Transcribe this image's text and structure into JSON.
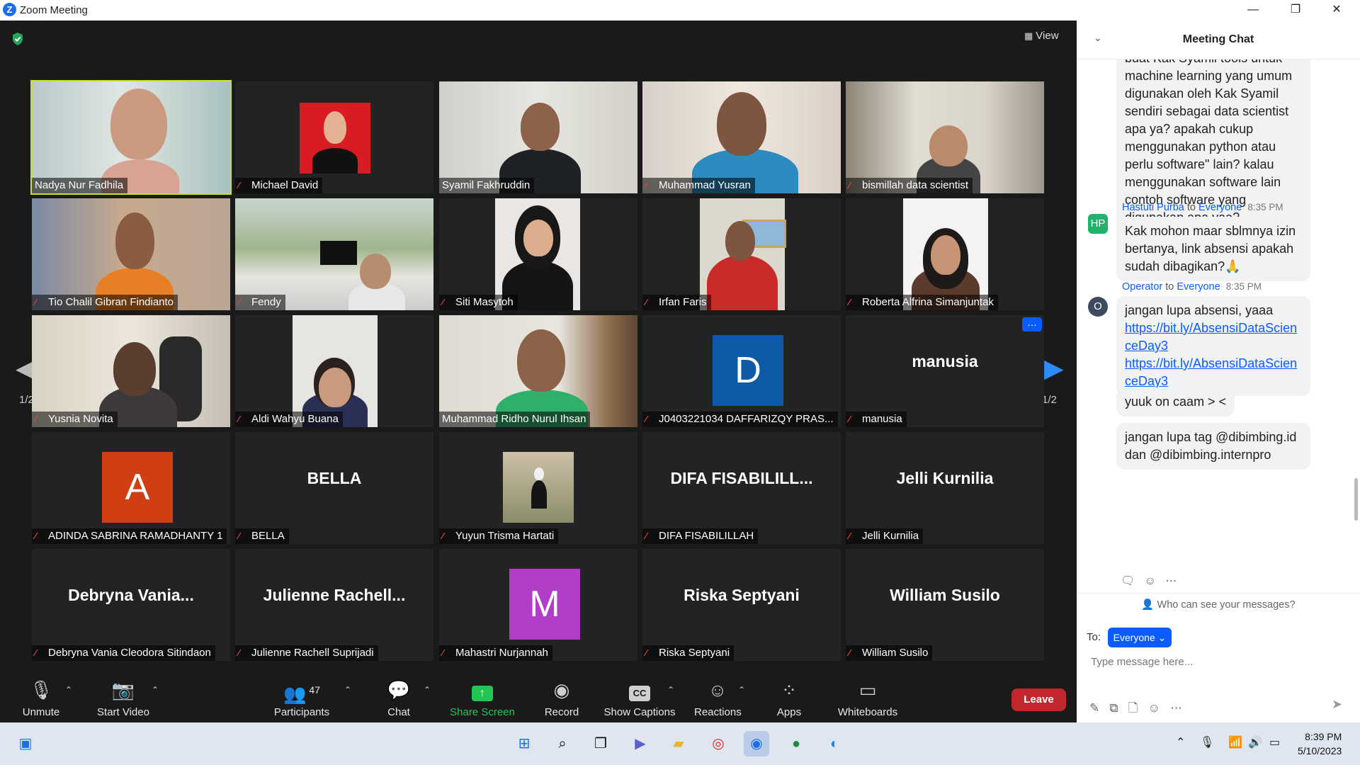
{
  "window": {
    "title": "Zoom Meeting",
    "logo": "Z",
    "minimize": "—",
    "maximize": "❐",
    "close": "✕"
  },
  "meeting": {
    "view_label": "View"
  },
  "pager": {
    "left": "1/2",
    "right": "1/2"
  },
  "tiles": [
    {
      "name": "Nadya Nur Fadhila"
    },
    {
      "name": "Michael David"
    },
    {
      "name": "Syamil Fakhruddin"
    },
    {
      "name": "Muhammad Yusran"
    },
    {
      "name": "bismillah data scientist"
    },
    {
      "name": "Tio Chalil Gibran Findianto"
    },
    {
      "name": "Fendy"
    },
    {
      "name": "Siti Masytoh"
    },
    {
      "name": "Irfan Faris"
    },
    {
      "name": "Roberta Alfrina Simanjuntak"
    },
    {
      "name": "Yusnia Novita"
    },
    {
      "name": "Aldi Wahyu Buana"
    },
    {
      "name": "Muhammad Ridho Nurul Ihsan"
    },
    {
      "name": "J0403221034 DAFFARIZQY PRAS...",
      "avatar": "D"
    },
    {
      "name": "manusia",
      "display": "manusia"
    },
    {
      "name": "ADINDA SABRINA RAMADHANTY 1",
      "avatar": "A"
    },
    {
      "name": "BELLA",
      "display": "BELLA"
    },
    {
      "name": "Yuyun Trisma Hartati"
    },
    {
      "name": "DIFA FISABILILLAH",
      "display": "DIFA  FISABILILL..."
    },
    {
      "name": "Jelli Kurnilia",
      "display": "Jelli Kurnilia"
    },
    {
      "name": "Debryna Vania Cleodora Sitindaon",
      "display": "Debryna  Vania..."
    },
    {
      "name": "Julienne Rachell Suprijadi",
      "display": "Julienne  Rachell..."
    },
    {
      "name": "Mahastri Nurjannah",
      "avatar": "M"
    },
    {
      "name": "Riska Septyani",
      "display": "Riska Septyani"
    },
    {
      "name": "William Susilo",
      "display": "William Susilo"
    }
  ],
  "toolbar": {
    "unmute": "Unmute",
    "start_video": "Start Video",
    "participants": "Participants",
    "participants_count": "47",
    "chat": "Chat",
    "share_screen": "Share Screen",
    "record": "Record",
    "show_captions": "Show Captions",
    "captions_icon": "CC",
    "reactions": "Reactions",
    "apps": "Apps",
    "whiteboards": "Whiteboards",
    "leave": "Leave"
  },
  "chat": {
    "title": "Meeting Chat",
    "messages": [
      {
        "text": "buat Kak Syamil tools untuk machine learning yang umum digunakan oleh Kak Syamil sendiri sebagai data scientist apa ya? apakah cukup menggunakan python atau perlu software\" lain? kalau menggunakan software lain contoh software yang digunakan apa yaa?"
      },
      {
        "sender": "Hastuti Purba",
        "to_word": "to",
        "to": "Everyone",
        "time": "8:35 PM",
        "initials": "HP",
        "text": "Kak mohon maar sblmnya izin bertanya, link absensi apakah sudah dibagikan?🙏"
      },
      {
        "sender": "Operator",
        "to_word": "to",
        "to": "Everyone",
        "time": "8:35 PM",
        "initials": "O",
        "text": "jangan lupa absensi, yaaa",
        "link1": "https://bit.ly/AbsensiDataScienceDay3",
        "link2": "https://bit.ly/AbsensiDataScienceDay3"
      },
      {
        "text": "yuuk on caam > <"
      },
      {
        "text": "jangan lupa tag @dibimbing.id dan @dibimbing.internpro"
      }
    ],
    "who_can_see": "Who can see your messages?",
    "to_label": "To:",
    "recipient": "Everyone",
    "placeholder": "Type message here..."
  },
  "taskbar": {
    "time": "8:39 PM",
    "date": "5/10/2023"
  }
}
